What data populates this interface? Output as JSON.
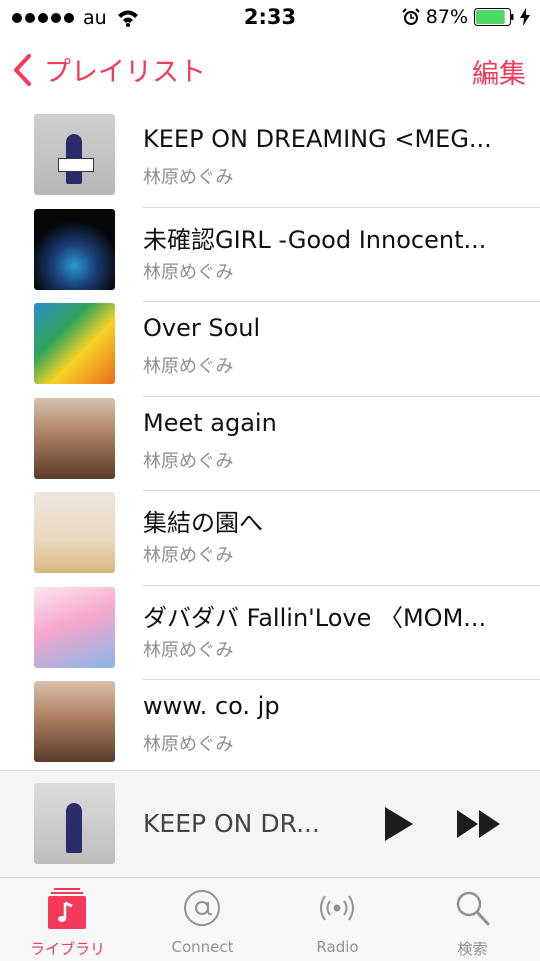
{
  "status_bar": {
    "carrier": "au",
    "time": "2:33",
    "battery": "87%",
    "battery_level": 0.87
  },
  "nav": {
    "back_label": "プレイリスト",
    "edit_label": "編集"
  },
  "songs": [
    {
      "title": "KEEP ON DREAMING <MEG...",
      "artist": "林原めぐみ"
    },
    {
      "title": "未確認GIRL -Good Innocent...",
      "artist": "林原めぐみ"
    },
    {
      "title": "Over Soul",
      "artist": "林原めぐみ"
    },
    {
      "title": "Meet again",
      "artist": "林原めぐみ"
    },
    {
      "title": "集結の園へ",
      "artist": "林原めぐみ"
    },
    {
      "title": "ダバダバ Fallin'Love 〈MOM...",
      "artist": "林原めぐみ"
    },
    {
      "title": "www. co. jp",
      "artist": "林原めぐみ"
    }
  ],
  "now_playing": {
    "title": "KEEP ON DR..."
  },
  "tabs": [
    {
      "label": "ライブラリ",
      "icon": "music-note-icon",
      "active": true
    },
    {
      "label": "Connect",
      "icon": "at-sign-icon",
      "active": false
    },
    {
      "label": "Radio",
      "icon": "radio-broadcast-icon",
      "active": false
    },
    {
      "label": "検索",
      "icon": "search-icon",
      "active": false
    }
  ],
  "colors": {
    "accent": "#f4395a",
    "battery_green": "#4cd964",
    "secondary_text": "#8e8e93"
  }
}
